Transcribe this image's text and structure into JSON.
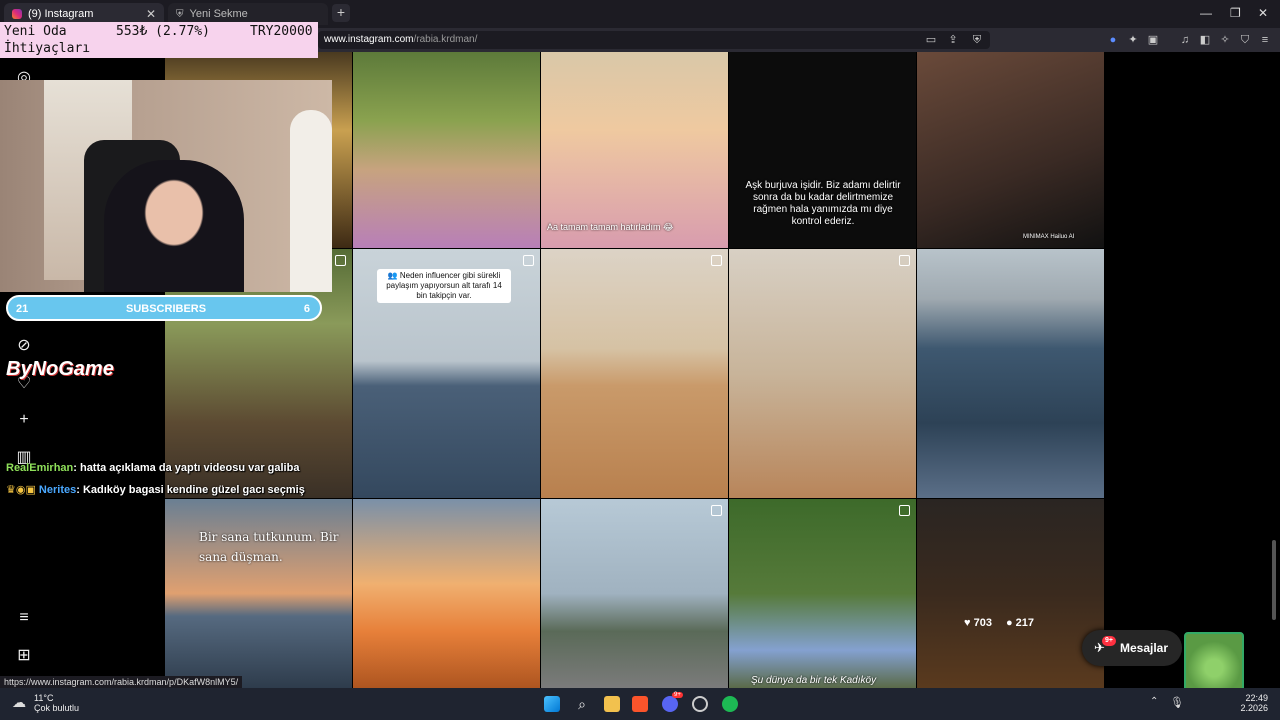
{
  "browser": {
    "tabs": [
      {
        "label": "(9) Instagram",
        "active": true
      },
      {
        "label": "Yeni Sekme",
        "active": false
      }
    ],
    "url_host": "www.instagram.com",
    "url_path": "/rabia.krdman/",
    "status_url": "https://www.instagram.com/rabia.krdman/p/DKafW8nlMY5/"
  },
  "overlay": {
    "title_line1": "Yeni Oda",
    "title_line2": "İhtiyaçları",
    "amount": "553₺ (2.77%)",
    "goal": "TRY20000"
  },
  "subscribers": {
    "left": "21",
    "label": "SUBSCRIBERS",
    "right": "6"
  },
  "sponsor": "ByNoGame",
  "chat": [
    {
      "user": "RealEmirhan",
      "message": ": hatta açıklama da yaptı videosu var galiba",
      "user_color": "#8fe05a"
    },
    {
      "user": "Nerites",
      "message": ": Kadıköy bagasi kendine güzel gacı seçmiş",
      "user_color": "#4aa8ff"
    }
  ],
  "posts": {
    "captions": {
      "r1c2": "Aa tamam tamam hatırladım 😂",
      "r1c3": "Aşk burjuva işidir. Biz adamı delirtir sonra da bu kadar delirtmemize rağmen hala yanımızda mı diye kontrol ederiz.",
      "r1c4": "MINIMAX  Hailuo AI",
      "r2c1": "👥 Neden influencer gibi sürekli paylaşım yapıyorsun alt tarafı 14 bin takipçin var.",
      "r3c0": "Bir sana tutkunum. Bir sana düşman.",
      "r3c3": "Şu dünya da bir tek Kadıköy"
    },
    "hover_likes": "703",
    "hover_comments": "217"
  },
  "messages_button": {
    "label": "Mesajlar",
    "badge": "9+"
  },
  "taskbar": {
    "weather_temp": "11°C",
    "weather_desc": "Çok bulutlu",
    "time": "22:49",
    "date": "2.2026",
    "discord_badge": "9+"
  },
  "colors": {
    "overlay_bg": "#f7d3ed",
    "subs_bg": "#68c6ee",
    "taskbar_bg": "#1f2430"
  }
}
